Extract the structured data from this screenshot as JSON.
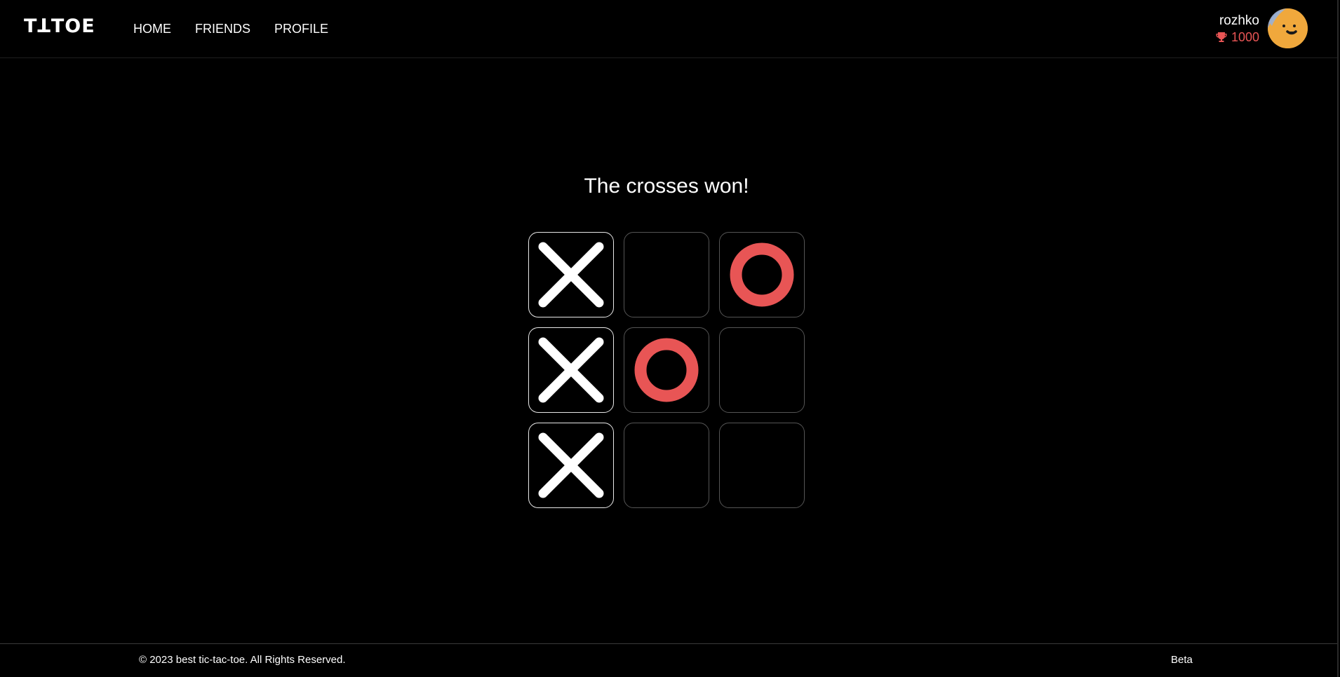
{
  "header": {
    "logo": "TꓕTOE",
    "nav": [
      {
        "label": "HOME"
      },
      {
        "label": "FRIENDS"
      },
      {
        "label": "PROFILE"
      }
    ],
    "user": {
      "name": "rozhko",
      "rating": "1000",
      "rating_icon": "trophy-icon",
      "avatar_icon": "smiley-avatar"
    }
  },
  "game": {
    "status": "The crosses won!",
    "board": [
      [
        "X",
        "",
        "O"
      ],
      [
        "X",
        "O",
        ""
      ],
      [
        "X",
        "",
        ""
      ]
    ],
    "colors": {
      "cross": "#ffffff",
      "nought": "#e85555",
      "winning_border": "#e8e8e8",
      "cell_border": "#555555"
    }
  },
  "footer": {
    "copyright": "© 2023 best tic-tac-toe. All Rights Reserved.",
    "version": "Beta"
  }
}
